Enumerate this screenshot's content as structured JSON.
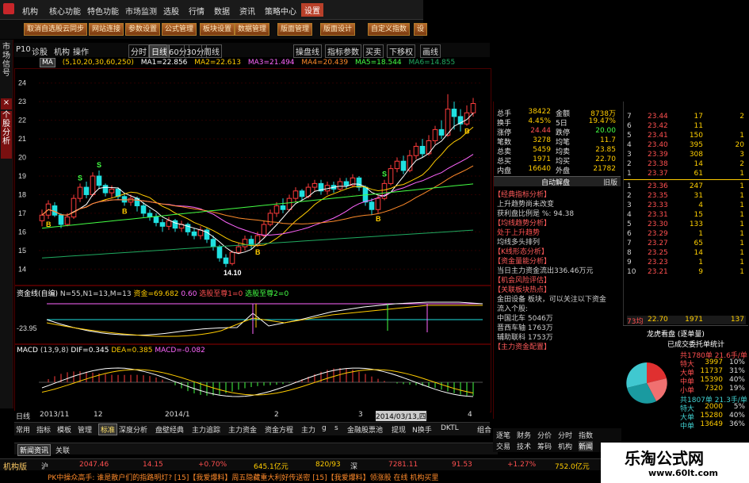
{
  "menubar": {
    "items": [
      "机构",
      "核心功能",
      "特色功能",
      "市场监测",
      "选股",
      "行情",
      "数据",
      "资讯",
      "策略中心",
      "设置"
    ],
    "active": "设置"
  },
  "toolbar": {
    "buttons": [
      "取消自选股云同步",
      "网站连接",
      "参数设置",
      "公式管理",
      "板块设置",
      "数据管理",
      "版面管理",
      "版面设计",
      "自定义指数",
      "设"
    ]
  },
  "left_tabs": {
    "top": "市场信号",
    "bottom": "个股分析",
    "close": "×"
  },
  "chart_toolbar": {
    "code": "P10",
    "tabs": [
      "诊股",
      "机构",
      "操作"
    ],
    "periods": [
      "分时",
      "日线",
      "60分",
      "30分",
      "周线"
    ],
    "right": [
      "操盘线",
      "指标参数",
      "买卖",
      "下移权",
      "画线"
    ]
  },
  "ma_legend": {
    "label": "MA",
    "params": "(5,10,20,30,60,250)",
    "ma1": "MA1=22.856",
    "ma2": "MA2=22.613",
    "ma3": "MA3=21.494",
    "ma4": "MA4=20.439",
    "ma5": "MA5=18.544",
    "ma6": "MA6=14.855"
  },
  "colors": {
    "up": "#ff3c3c",
    "down": "#20e0e0",
    "ma1": "#ffffff",
    "ma2": "#ffcc00",
    "ma3": "#ff66ff",
    "ma4": "#ff8a2a",
    "ma5": "#44ff44",
    "ma6": "#20aa60"
  },
  "chart_data": [
    {
      "type": "candlestick",
      "title": "",
      "y_ticks": [
        "24",
        "23",
        "22",
        "21",
        "20",
        "19",
        "18",
        "17",
        "16",
        "15",
        "14"
      ],
      "ylim": [
        13.5,
        24.5
      ],
      "annotations": [
        "S",
        "B",
        "S",
        "B",
        "S",
        "B",
        "B",
        "B",
        "14.10"
      ],
      "candles": [
        [
          16.6,
          16.9,
          16.3,
          17.2
        ],
        [
          16.9,
          17.5,
          16.7,
          17.7
        ],
        [
          17.4,
          16.9,
          16.8,
          17.6
        ],
        [
          16.9,
          16.4,
          16.2,
          17.0
        ],
        [
          16.4,
          16.8,
          16.3,
          17.0
        ],
        [
          16.8,
          17.8,
          16.7,
          18.0
        ],
        [
          17.8,
          18.4,
          17.6,
          18.6
        ],
        [
          18.4,
          18.0,
          17.8,
          18.7
        ],
        [
          18.0,
          19.0,
          17.9,
          19.2
        ],
        [
          19.0,
          18.5,
          18.3,
          19.3
        ],
        [
          18.5,
          18.1,
          17.9,
          18.6
        ],
        [
          18.1,
          18.3,
          17.8,
          18.5
        ],
        [
          18.3,
          17.9,
          17.7,
          18.4
        ],
        [
          17.9,
          17.6,
          17.4,
          18.1
        ],
        [
          17.6,
          17.8,
          17.4,
          18.0
        ],
        [
          17.8,
          17.4,
          17.1,
          17.9
        ],
        [
          17.4,
          17.0,
          16.8,
          17.6
        ],
        [
          17.0,
          16.8,
          16.6,
          17.2
        ],
        [
          16.8,
          16.5,
          16.3,
          17.0
        ],
        [
          16.5,
          16.3,
          16.0,
          16.7
        ],
        [
          16.3,
          16.6,
          16.1,
          16.8
        ],
        [
          16.6,
          16.2,
          16.0,
          16.7
        ],
        [
          16.2,
          16.4,
          16.0,
          16.6
        ],
        [
          16.4,
          16.0,
          15.8,
          16.5
        ],
        [
          16.0,
          15.8,
          15.6,
          16.2
        ],
        [
          15.8,
          16.1,
          15.6,
          16.3
        ],
        [
          16.1,
          15.6,
          15.4,
          16.2
        ],
        [
          15.6,
          15.2,
          15.0,
          15.8
        ],
        [
          15.2,
          14.6,
          14.4,
          15.3
        ],
        [
          14.6,
          14.3,
          14.1,
          14.8
        ],
        [
          14.3,
          14.9,
          14.2,
          15.0
        ],
        [
          14.9,
          15.2,
          14.8,
          15.4
        ],
        [
          15.2,
          15.6,
          15.0,
          15.8
        ],
        [
          15.6,
          15.3,
          15.1,
          15.8
        ],
        [
          15.3,
          15.8,
          15.2,
          16.0
        ],
        [
          15.8,
          16.4,
          15.7,
          16.6
        ],
        [
          16.4,
          17.0,
          16.3,
          17.2
        ],
        [
          17.0,
          17.4,
          16.8,
          17.6
        ],
        [
          17.4,
          17.2,
          17.0,
          17.8
        ],
        [
          17.2,
          17.8,
          17.1,
          18.0
        ],
        [
          17.8,
          18.2,
          17.6,
          18.4
        ],
        [
          18.2,
          17.9,
          17.7,
          18.3
        ],
        [
          17.9,
          18.4,
          17.8,
          18.6
        ],
        [
          18.4,
          18.6,
          18.2,
          18.8
        ],
        [
          18.6,
          18.2,
          18.0,
          18.8
        ],
        [
          18.2,
          18.5,
          18.0,
          18.7
        ],
        [
          18.5,
          18.3,
          18.1,
          18.7
        ],
        [
          18.3,
          18.7,
          18.2,
          18.9
        ],
        [
          18.7,
          18.5,
          18.3,
          18.9
        ],
        [
          18.5,
          18.9,
          18.4,
          19.1
        ],
        [
          18.9,
          18.4,
          18.2,
          19.0
        ],
        [
          18.4,
          17.6,
          17.4,
          18.5
        ],
        [
          17.6,
          17.2,
          16.9,
          17.8
        ],
        [
          17.2,
          17.8,
          17.0,
          18.0
        ],
        [
          17.8,
          18.6,
          17.7,
          18.8
        ],
        [
          18.6,
          19.4,
          18.5,
          19.6
        ],
        [
          19.4,
          19.8,
          19.2,
          20.0
        ],
        [
          19.8,
          19.3,
          19.1,
          20.1
        ],
        [
          19.3,
          20.1,
          19.2,
          20.4
        ],
        [
          20.1,
          20.6,
          19.9,
          20.8
        ],
        [
          20.6,
          20.2,
          20.0,
          21.0
        ],
        [
          20.2,
          20.9,
          20.1,
          21.2
        ],
        [
          20.9,
          21.5,
          20.7,
          21.7
        ],
        [
          21.5,
          21.2,
          21.0,
          22.0
        ],
        [
          21.2,
          22.6,
          21.1,
          23.4
        ],
        [
          22.6,
          22.2,
          21.5,
          23.0
        ],
        [
          22.2,
          21.8,
          21.4,
          22.6
        ],
        [
          21.8,
          22.4,
          21.7,
          22.8
        ],
        [
          22.4,
          22.9,
          22.2,
          23.2
        ]
      ]
    },
    {
      "type": "line",
      "title": "资金线(自编)",
      "params": "N=55,N1=13,M=13",
      "values_text": [
        "资金=69.682",
        "0.60",
        "选股至尊1=0",
        "选股至尊2=0"
      ],
      "left_value": "-23.95"
    },
    {
      "type": "bar",
      "title": "MACD",
      "params": "(13,9,8)",
      "dif": "DIF=0.345",
      "dea": "DEA=0.385",
      "macd": "MACD=-0.082"
    }
  ],
  "date_bar": [
    "日线",
    "2013/11",
    "12",
    "2014/1",
    "2",
    "3",
    "2014/03/13,四",
    "4"
  ],
  "bottom_tabs": [
    "常用",
    "指标",
    "模板",
    "管理",
    "标准",
    "深度分析",
    "盘壁经典",
    "主力追踪",
    "主力资金",
    "资金方程",
    "主力",
    "g",
    "s",
    "金融股票池",
    "提现",
    "N换手",
    "DKTL",
    "组合"
  ],
  "news_tabs": [
    "新闻资讯",
    "关联"
  ],
  "quote_table": [
    {
      "a": "总手",
      "b": "38422",
      "c": "金额",
      "d": "8738万"
    },
    {
      "a": "换手",
      "b": "4.45%",
      "c": "5日",
      "d": "19.47%"
    },
    {
      "a": "涨停",
      "b": "24.44",
      "c": "跌停",
      "d": "20.00"
    },
    {
      "a": "笔数",
      "b": "3278",
      "c": "均笔",
      "d": "11.7"
    },
    {
      "a": "总卖",
      "b": "5459",
      "c": "均卖",
      "d": "23.85"
    },
    {
      "a": "总买",
      "b": "1971",
      "c": "均买",
      "d": "22.70"
    },
    {
      "a": "内盘",
      "b": "16640",
      "c": "外盘",
      "d": "21782"
    }
  ],
  "auto_panel": {
    "title": "自动解盘",
    "close": "旧版",
    "sections": [
      {
        "head": "【经典指标分析】",
        "lines": [
          "上升趋势尚未改变",
          "获利盘比例是 %: 94.38"
        ]
      },
      {
        "head": "【均线趋势分析】",
        "lines": [
          "处于上升趋势",
          "均线多头排列"
        ]
      },
      {
        "head": "【K线形态分析】",
        "lines": []
      },
      {
        "head": "【资金量能分析】",
        "lines": [
          "当日主力资金流出336.46万元"
        ]
      },
      {
        "head": "【机会风险评估】",
        "lines": []
      },
      {
        "head": "【关联板块热点】",
        "lines": [
          "金田设备 板块，可以关注以下资金",
          "流入个股:",
          "中国北车 5046万",
          "晋西车轴 1763万",
          "辅助联科 1753万"
        ]
      },
      {
        "head": "【主力资金配置】",
        "lines": []
      }
    ]
  },
  "right_buttons": [
    "逐笔",
    "财务",
    "分价",
    "分时",
    "指数",
    "交易",
    "技术",
    "筹码",
    "机构",
    "新闻"
  ],
  "orderbook": {
    "sells": [
      {
        "lvl": "7",
        "pr": "23.44",
        "vo": "17",
        "ri": "2"
      },
      {
        "lvl": "6",
        "pr": "23.42",
        "vo": "11",
        "ri": ""
      },
      {
        "lvl": "5",
        "pr": "23.41",
        "vo": "150",
        "ri": "1"
      },
      {
        "lvl": "4",
        "pr": "23.40",
        "vo": "395",
        "ri": "20"
      },
      {
        "lvl": "3",
        "pr": "23.39",
        "vo": "308",
        "ri": "3"
      },
      {
        "lvl": "2",
        "pr": "23.38",
        "vo": "14",
        "ri": "2"
      },
      {
        "lvl": "1",
        "pr": "23.37",
        "vo": "61",
        "ri": "1"
      }
    ],
    "buys": [
      {
        "lvl": "1",
        "pr": "23.36",
        "vo": "247",
        "ri": "1"
      },
      {
        "lvl": "2",
        "pr": "23.35",
        "vo": "31",
        "ri": "1"
      },
      {
        "lvl": "3",
        "pr": "23.33",
        "vo": "4",
        "ri": "1"
      },
      {
        "lvl": "4",
        "pr": "23.31",
        "vo": "15",
        "ri": "1"
      },
      {
        "lvl": "5",
        "pr": "23.30",
        "vo": "133",
        "ri": "1"
      },
      {
        "lvl": "6",
        "pr": "23.29",
        "vo": "1",
        "ri": "1"
      },
      {
        "lvl": "7",
        "pr": "23.27",
        "vo": "65",
        "ri": "1"
      },
      {
        "lvl": "8",
        "pr": "23.25",
        "vo": "14",
        "ri": "1"
      },
      {
        "lvl": "9",
        "pr": "23.23",
        "vo": "1",
        "ri": "1"
      },
      {
        "lvl": "10",
        "pr": "23.21",
        "vo": "9",
        "ri": "1"
      }
    ],
    "foot": {
      "a": "73均",
      "b": "22.70",
      "c": "1971",
      "d": "137"
    }
  },
  "dragon": {
    "title": "龙虎看盘 (逐单量)",
    "subtitle": "已成交委托单统计",
    "sell_head": "共1780单 21.6手/单",
    "buy_head": "共1807单 21.3手/单",
    "sell": [
      [
        "特大",
        "3997",
        "10%"
      ],
      [
        "大单",
        "11737",
        "31%"
      ],
      [
        "中单",
        "15390",
        "40%"
      ],
      [
        "小单",
        "7320",
        "19%"
      ]
    ],
    "buy": [
      [
        "特大",
        "2000",
        "5%"
      ],
      [
        "大单",
        "15280",
        "40%"
      ],
      [
        "中单",
        "13649",
        "36%"
      ]
    ]
  },
  "status": {
    "label": "机构版",
    "items": [
      {
        "n": "沪",
        "v": "2047.46",
        "c": "14.15",
        "p": "+0.70%",
        "m": "645.1亿元"
      },
      {
        "n": "820/93",
        "v": "",
        "c": "",
        "p": "深",
        "m": ""
      },
      {
        "n": "",
        "v": "7281.11",
        "c": "91.53",
        "p": "+1.27%",
        "m": "752.0亿元"
      }
    ]
  },
  "ticker": "PK中操众高手: 谁是散户们的指路明灯?    [15]【我爱爆料】周五隐藏重大利好传送密    [15]【我爱爆料】领涨股    在线 机构买里",
  "watermark": {
    "title": "乐淘公式网",
    "url": "www.60lt.com"
  }
}
